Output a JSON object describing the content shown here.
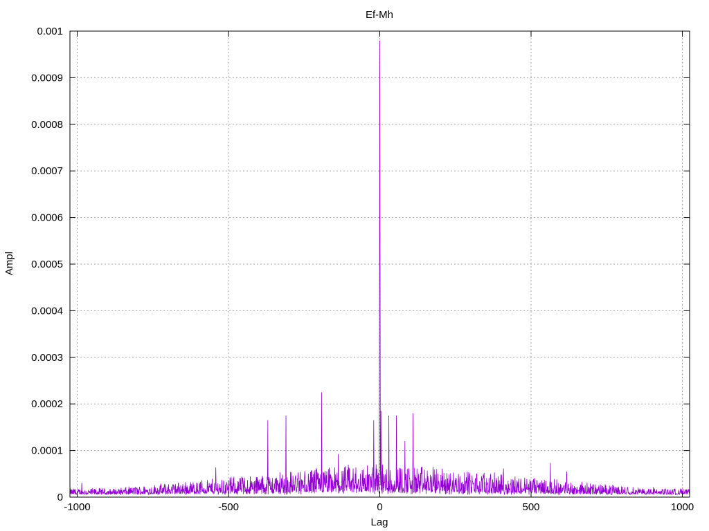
{
  "chart_data": {
    "type": "line",
    "title": "Ef-Mh",
    "xlabel": "Lag",
    "ylabel": "Ampl",
    "xlim": [
      -1024,
      1024
    ],
    "ylim": [
      0,
      0.001
    ],
    "x_ticks": [
      -1000,
      -500,
      0,
      500,
      1000
    ],
    "x_tick_labels": [
      "-1000",
      "-500",
      "0",
      "500",
      "1000"
    ],
    "y_ticks": [
      0,
      0.0001,
      0.0002,
      0.0003,
      0.0004,
      0.0005,
      0.0006,
      0.0007,
      0.0008,
      0.0009,
      0.001
    ],
    "y_tick_labels": [
      "0",
      "0.0001",
      "0.0002",
      "0.0003",
      "0.0004",
      "0.0005",
      "0.0006",
      "0.0007",
      "0.0008",
      "0.0009",
      "0.001"
    ],
    "grid": true,
    "series": [
      {
        "color": "#9400d3",
        "peaks": [
          {
            "x": 0,
            "y": 0.00098
          },
          {
            "x": 1,
            "y": 0.00057
          },
          {
            "x": -1,
            "y": 0.00043
          },
          {
            "x": -192,
            "y": 0.000225
          },
          {
            "x": 110,
            "y": 0.00018
          },
          {
            "x": -310,
            "y": 0.000175
          },
          {
            "x": 30,
            "y": 0.000175
          },
          {
            "x": 55,
            "y": 0.000175
          },
          {
            "x": -370,
            "y": 0.000165
          },
          {
            "x": -20,
            "y": 0.000165
          },
          {
            "x": 4,
            "y": 0.000185
          }
        ],
        "envelope_center": 3e-05,
        "envelope_amplitude": 4e-05
      }
    ]
  }
}
